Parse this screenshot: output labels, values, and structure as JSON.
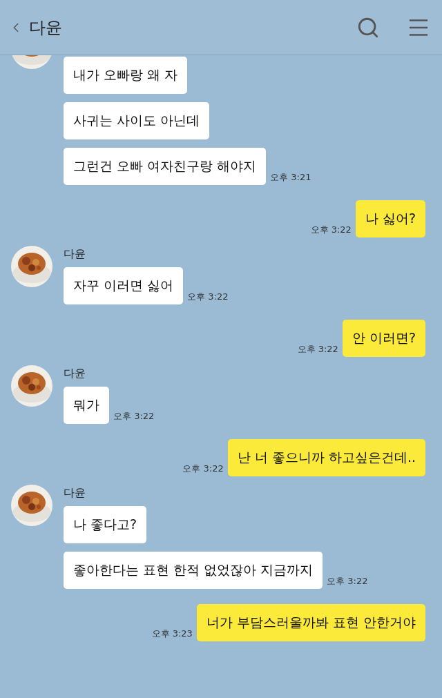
{
  "header": {
    "title": "다윤"
  },
  "messages": [
    {
      "kind": "received",
      "bubbles": [
        "내가 오빠랑 왜 자",
        "사귀는 사이도 아닌데",
        "그런건 오빠 여자친구랑 해야지"
      ],
      "time": "오후 3:21"
    },
    {
      "kind": "sent",
      "bubbles": [
        "나 싫어?"
      ],
      "time": "오후 3:22"
    },
    {
      "kind": "received",
      "name": "다윤",
      "bubbles": [
        "자꾸 이러면 싫어"
      ],
      "time": "오후 3:22"
    },
    {
      "kind": "sent",
      "bubbles": [
        "안 이러면?"
      ],
      "time": "오후 3:22"
    },
    {
      "kind": "received",
      "name": "다윤",
      "bubbles": [
        "뭐가"
      ],
      "time": "오후 3:22"
    },
    {
      "kind": "sent",
      "bubbles": [
        "난 너 좋으니까 하고싶은건데.."
      ],
      "time": "오후 3:22"
    },
    {
      "kind": "received",
      "name": "다윤",
      "bubbles": [
        "나 좋다고?",
        "좋아한다는 표현 한적 없었잖아 지금까지"
      ],
      "time": "오후 3:22"
    },
    {
      "kind": "sent",
      "bubbles": [
        "너가 부담스러울까봐 표현 안한거야"
      ],
      "time": "오후 3:23"
    }
  ]
}
